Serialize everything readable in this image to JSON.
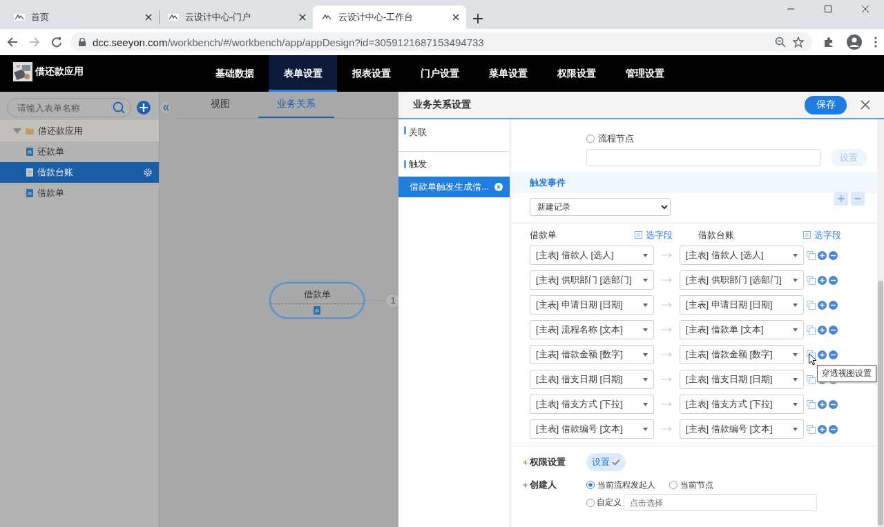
{
  "browser": {
    "tabs": [
      {
        "title": "首页",
        "selected": false
      },
      {
        "title": "云设计中心-门户",
        "selected": false
      },
      {
        "title": "云设计中心-工作台",
        "selected": true
      }
    ],
    "url_host": "dcc.seeyon.com",
    "url_path": "/workbench/#/workbench/app/appDesign?id=3059121687153494733"
  },
  "app": {
    "name": "借还款应用",
    "nav": [
      {
        "label": "基础数据",
        "selected": false
      },
      {
        "label": "表单设置",
        "selected": true
      },
      {
        "label": "报表设置",
        "selected": false
      },
      {
        "label": "门户设置",
        "selected": false
      },
      {
        "label": "菜单设置",
        "selected": false
      },
      {
        "label": "权限设置",
        "selected": false
      },
      {
        "label": "管理设置",
        "selected": false
      }
    ]
  },
  "sidebar": {
    "search": {
      "placeholder": "请输入表单名称"
    },
    "tree": [
      {
        "label": "借还款应用",
        "expanded": true,
        "children": [
          {
            "label": "还款单",
            "kind": "form",
            "selected": false
          },
          {
            "label": "借款台账",
            "kind": "ledger",
            "selected": true
          },
          {
            "label": "借款单",
            "kind": "form",
            "selected": false
          }
        ]
      }
    ]
  },
  "canvas": {
    "tabs": [
      {
        "label": "视图",
        "selected": false
      },
      {
        "label": "业务关系",
        "selected": true
      }
    ],
    "node": {
      "label": "借款单"
    },
    "count": "1"
  },
  "panel": {
    "title": "业务关系设置",
    "save": "保存",
    "sections": [
      {
        "title": "关联"
      },
      {
        "title": "触发",
        "items": [
          {
            "label": "借款单触发生成借...",
            "selected": true
          }
        ]
      }
    ],
    "node_option": {
      "label": "流程节点",
      "selected": false
    },
    "node_button": {
      "label": "设置",
      "disabled": true
    },
    "trigger_event": {
      "title": "触发事件",
      "value": "新建记录"
    },
    "mapping": {
      "source_title": "借款单",
      "source_pick": "选字段",
      "target_title": "借款台账",
      "target_pick": "选字段",
      "rows": [
        {
          "source": "[主表] 借款人 [选人]",
          "target": "[主表] 借款人 [选人]"
        },
        {
          "source": "[主表] 供职部门 [选部门]",
          "target": "[主表] 供职部门 [选部门]"
        },
        {
          "source": "[主表] 申请日期 [日期]",
          "target": "[主表] 申请日期 [日期]"
        },
        {
          "source": "[主表] 流程名称 [文本]",
          "target": "[主表] 借款单 [文本]"
        },
        {
          "source": "[主表] 借款金额 [数字]",
          "target": "[主表] 借款金额 [数字]"
        },
        {
          "source": "[主表] 借支日期 [日期]",
          "target": "[主表] 借支日期 [日期]"
        },
        {
          "source": "[主表] 借支方式 [下拉]",
          "target": "[主表] 借支方式 [下拉]"
        },
        {
          "source": "[主表] 借款编号 [文本]",
          "target": "[主表] 借款编号 [文本]"
        }
      ],
      "tooltip": "穿透视图设置"
    },
    "permission": {
      "label": "权限设置",
      "required": true,
      "button": "设置",
      "done": true
    },
    "creator": {
      "label": "创建人",
      "required": true,
      "options": [
        {
          "label": "当前流程发起人",
          "selected": true
        },
        {
          "label": "当前节点",
          "selected": false
        }
      ],
      "custom": {
        "label": "自定义",
        "selected": false,
        "placeholder": "点击选择"
      }
    }
  }
}
